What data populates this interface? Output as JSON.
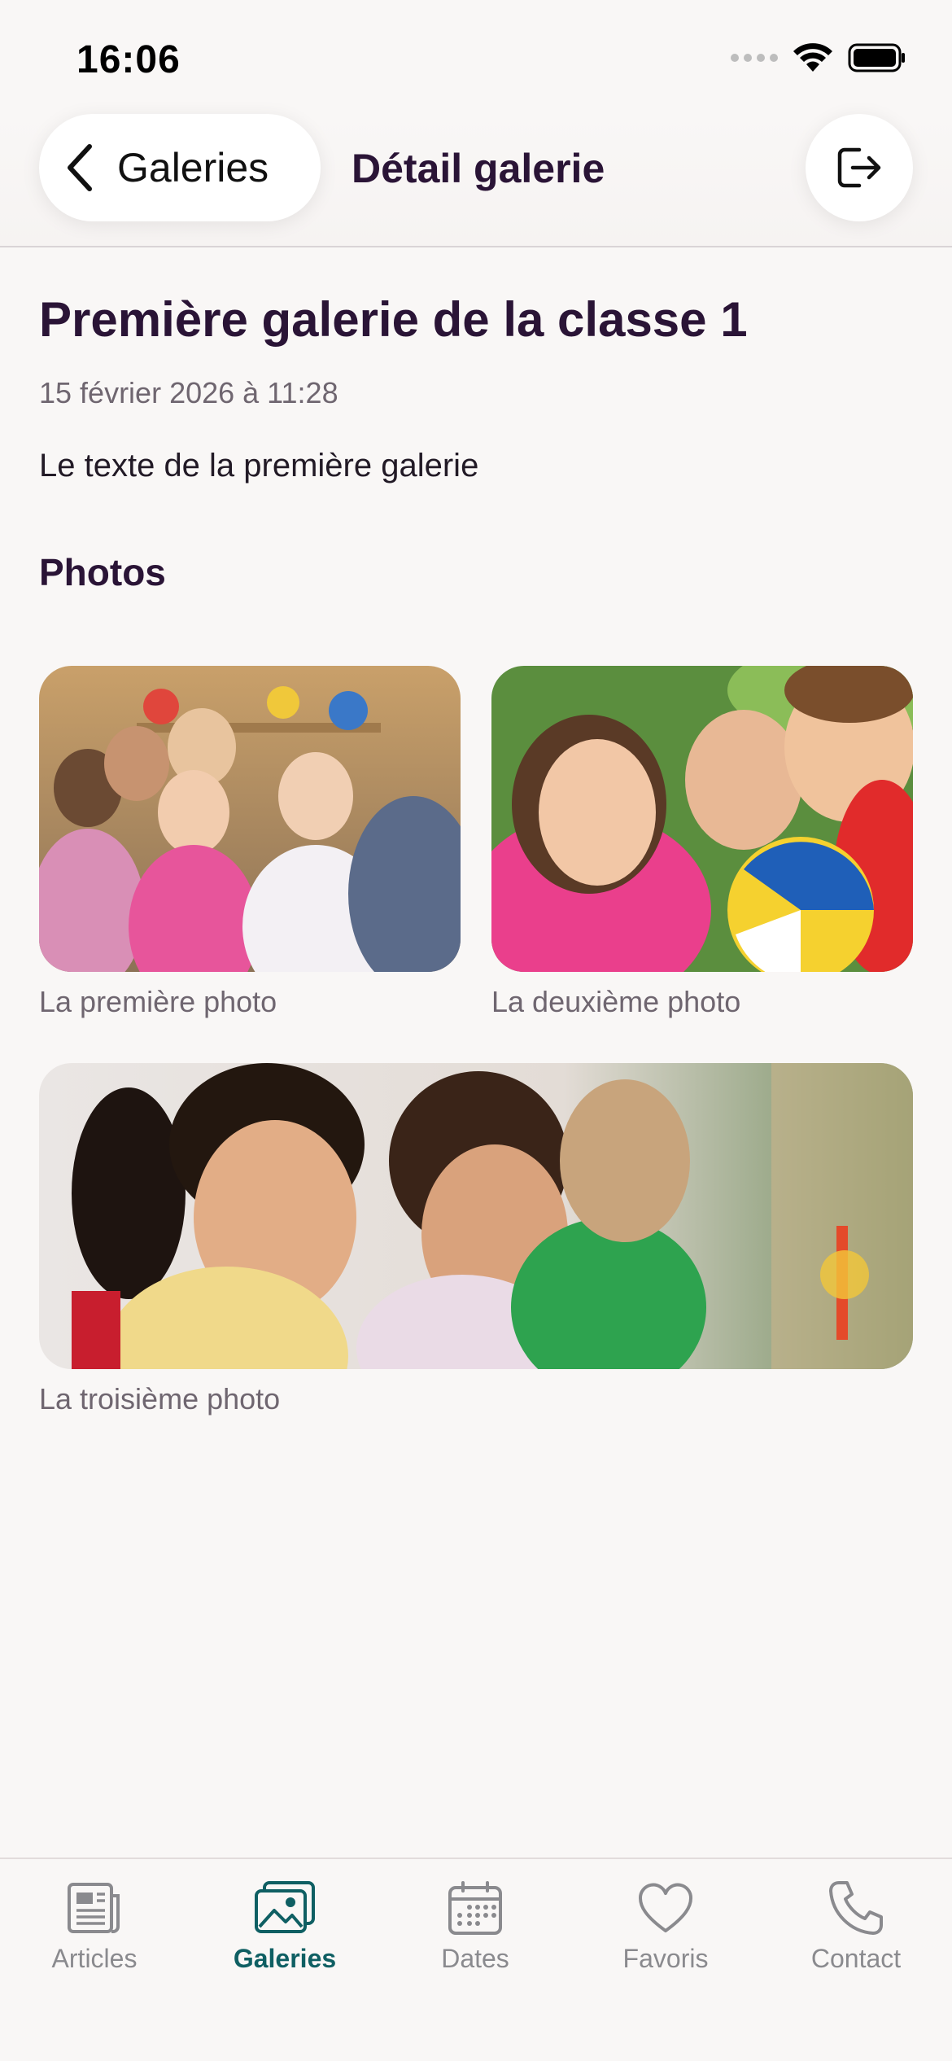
{
  "status_bar": {
    "time": "16:06"
  },
  "header": {
    "back_label": "Galeries",
    "title": "Détail galerie"
  },
  "gallery": {
    "title": "Première galerie de la classe 1",
    "date": "15 février 2026 à 11:28",
    "text": "Le texte de la première galerie",
    "photos_heading": "Photos",
    "photos": [
      {
        "caption": "La première photo"
      },
      {
        "caption": "La deuxième photo"
      },
      {
        "caption": "La troisième photo"
      }
    ]
  },
  "tab_bar": {
    "items": [
      {
        "label": "Articles",
        "icon": "newspaper-icon"
      },
      {
        "label": "Galeries",
        "icon": "photo-icon",
        "active": true
      },
      {
        "label": "Dates",
        "icon": "calendar-icon"
      },
      {
        "label": "Favoris",
        "icon": "heart-icon"
      },
      {
        "label": "Contact",
        "icon": "phone-icon"
      }
    ]
  },
  "colors": {
    "accent": "#0f5f63",
    "title": "#2a1436",
    "background": "#f9f7f6",
    "muted": "#6f6670"
  }
}
